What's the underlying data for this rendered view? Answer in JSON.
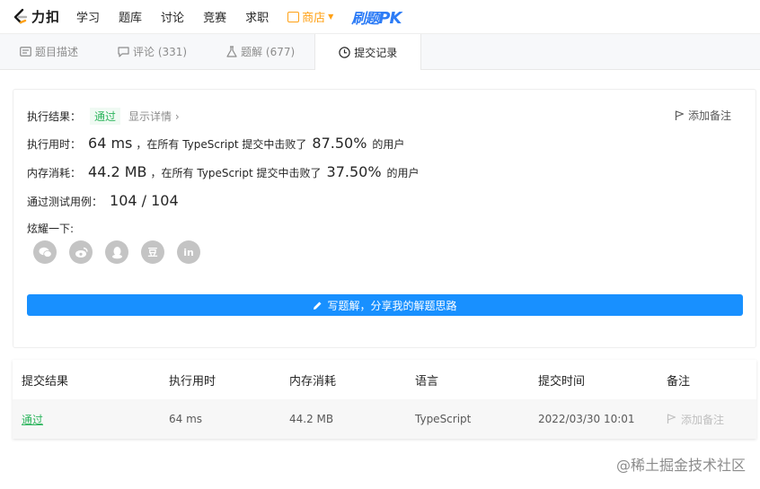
{
  "brand": {
    "logo_text": "力扣"
  },
  "nav": {
    "items": [
      "学习",
      "题库",
      "讨论",
      "竞赛",
      "求职"
    ],
    "store_label": "商店",
    "pk_brand": "刷题",
    "pk_suffix": "PK"
  },
  "tabs": [
    {
      "label": "题目描述"
    },
    {
      "label": "评论 (331)"
    },
    {
      "label": "题解 (677)"
    },
    {
      "label": "提交记录"
    }
  ],
  "result": {
    "label_result": "执行结果：",
    "status": "通过",
    "detail_link": "显示详情",
    "add_note": "添加备注",
    "label_time": "执行用时：",
    "time_value": "64 ms",
    "time_beat_text": "，在所有 TypeScript 提交中击败了",
    "time_percent": "87.50%",
    "users_text": "的用户",
    "label_memory": "内存消耗：",
    "memory_value": "44.2 MB",
    "memory_beat_text": "，在所有 TypeScript 提交中击败了",
    "memory_percent": "37.50%",
    "label_testcases": "通过测试用例：",
    "testcases_value": "104 / 104",
    "share_label": "炫耀一下:",
    "write_button": "写题解，分享我的解题思路"
  },
  "social": [
    "wechat-icon",
    "weibo-icon",
    "qq-icon",
    "douban-icon",
    "linkedin-icon"
  ],
  "social_glyphs": {
    "douban": "豆",
    "linkedin": "in"
  },
  "table": {
    "headers": [
      "提交结果",
      "执行用时",
      "内存消耗",
      "语言",
      "提交时间",
      "备注"
    ],
    "rows": [
      {
        "status": "通过",
        "time": "64 ms",
        "memory": "44.2 MB",
        "language": "TypeScript",
        "submitted": "2022/03/30 10:01",
        "note": "添加备注"
      }
    ]
  },
  "watermark": "@稀土掘金技术社区",
  "colors": {
    "accent": "#1890ff",
    "pass": "#2db55d",
    "store": "#ffa116",
    "pk": "#2d7cf6"
  }
}
